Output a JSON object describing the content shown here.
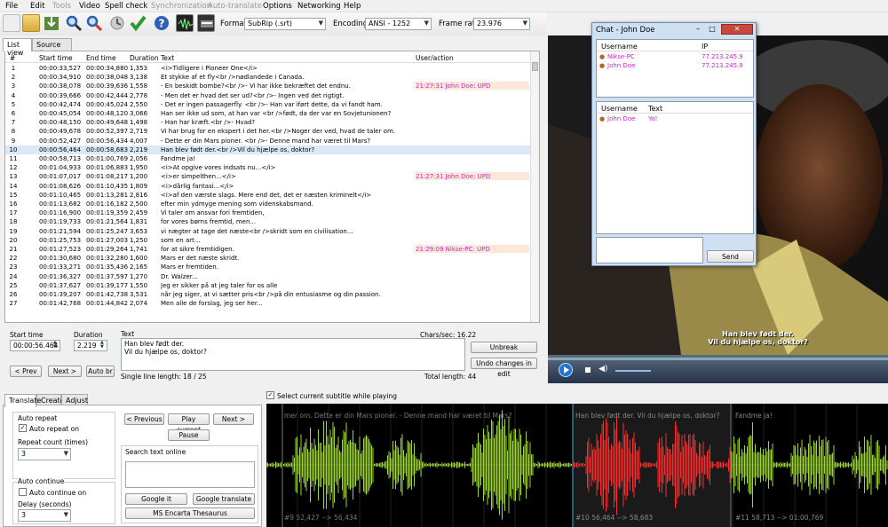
{
  "menu": [
    "File",
    "Edit",
    "Tools",
    "Video",
    "Spell check",
    "Synchronization",
    "Auto-translate",
    "Options",
    "Networking",
    "Help"
  ],
  "menu_disabled": [
    false,
    false,
    true,
    false,
    false,
    true,
    true,
    false,
    false,
    false
  ],
  "toolbar": {
    "format_label": "Format",
    "format_value": "SubRip (.srt)",
    "encoding_label": "Encoding",
    "encoding_value": "ANSI - 1252",
    "framerate_label": "Frame rate",
    "framerate_value": "23.976"
  },
  "tabs": {
    "list": "List view",
    "source": "Source view"
  },
  "columns": {
    "num": "#",
    "start": "Start time",
    "end": "End time",
    "dur": "Duration",
    "text": "Text",
    "ua": "User/action"
  },
  "rows": [
    [
      "1",
      "00:00:33,527",
      "00:00:34,880",
      "1,353",
      "<i>Tidligere i Pioneer One</i>",
      ""
    ],
    [
      "2",
      "00:00:34,910",
      "00:00:38,048",
      "3,138",
      "Et stykke af et fly<br />nødlandede i Canada.",
      ""
    ],
    [
      "3",
      "00:00:38,078",
      "00:00:39,636",
      "1,558",
      "- En beskidt bombe?<br />- Vi har ikke bekræftet det endnu.",
      "21:27:31 John Doe: UPD"
    ],
    [
      "4",
      "00:00:39,666",
      "00:00:42,444",
      "2,778",
      "- Men det er hvad det ser ud?<br />- Ingen ved det rigtigt.",
      ""
    ],
    [
      "5",
      "00:00:42,474",
      "00:00:45,024",
      "2,550",
      "- Det er ingen passagerfly. <br />- Han var iført dette, da vi fandt ham.",
      ""
    ],
    [
      "6",
      "00:00:45,054",
      "00:00:48,120",
      "3,066",
      "Han ser ikke ud som, at han var <br />født, da der var en Sovjetunionen?",
      ""
    ],
    [
      "7",
      "00:00:48,150",
      "00:00:49,648",
      "1,498",
      "- Han har kræft.<br />- Hvad?",
      ""
    ],
    [
      "8",
      "00:00:49,678",
      "00:00:52,397",
      "2,719",
      "Vi har brug for en ekspert i det her.<br />Noger der ved, hvad de taler om.",
      ""
    ],
    [
      "9",
      "00:00:52,427",
      "00:00:56,434",
      "4,007",
      "- Dette er din Mars pioner. <br />- Denne mand har været til Mars?",
      ""
    ],
    [
      "10",
      "00:00:56,464",
      "00:00:58,683",
      "2,219",
      "Han blev født der.<br />Vil du hjælpe os, doktor?",
      ""
    ],
    [
      "11",
      "00:00:58,713",
      "00:01:00,769",
      "2,056",
      "Fandme ja!",
      ""
    ],
    [
      "12",
      "00:01:04,933",
      "00:01:06,883",
      "1,950",
      "<i>At opgive vores indsats nu...</i>",
      ""
    ],
    [
      "13",
      "00:01:07,017",
      "00:01:08,217",
      "1,200",
      "<i>er simpelthen...</i>",
      "21:27:31 John Doe: UPD"
    ],
    [
      "14",
      "00:01:08,626",
      "00:01:10,435",
      "1,809",
      "<i>dårlig fantasi...</i>",
      ""
    ],
    [
      "15",
      "00:01:10,465",
      "00:01:13,281",
      "2,816",
      "<i>af den værste slags. Mere end det, det er næsten kriminelt</i>",
      ""
    ],
    [
      "16",
      "00:01:13,682",
      "00:01:16,182",
      "2,500",
      "efter min ydmyge mening som videnskabsmand.",
      ""
    ],
    [
      "17",
      "00:01:16,900",
      "00:01:19,359",
      "2,459",
      "Vi taler om ansvar fori fremtiden,",
      ""
    ],
    [
      "18",
      "00:01:19,733",
      "00:01:21,564",
      "1,831",
      "for vores børns fremtid, men...",
      ""
    ],
    [
      "19",
      "00:01:21,594",
      "00:01:25,247",
      "3,653",
      "vi nægter at tage det næste<br />skridt som en civilisation...",
      ""
    ],
    [
      "20",
      "00:01:25,753",
      "00:01:27,003",
      "1,250",
      "som en art...",
      ""
    ],
    [
      "21",
      "00:01:27,523",
      "00:01:29,264",
      "1,741",
      "for at sikre fremtidigen.",
      "21:29:09 Nikse-PC: UPD"
    ],
    [
      "22",
      "00:01:30,680",
      "00:01:32,280",
      "1,600",
      "Mars er det næste skridt.",
      ""
    ],
    [
      "23",
      "00:01:33,271",
      "00:01:35,436",
      "2,165",
      "Mars er fremtiden.",
      ""
    ],
    [
      "24",
      "00:01:36,327",
      "00:01:37,597",
      "1,270",
      "Dr. Walzer...",
      ""
    ],
    [
      "25",
      "00:01:37,627",
      "00:01:39,177",
      "1,550",
      "Jeg er sikker på at jeg taler for os alle",
      ""
    ],
    [
      "26",
      "00:01:39,207",
      "00:01:42,738",
      "3,531",
      "når jeg siger, at vi sætter pris<br />på din entusiasme og din passion.",
      ""
    ],
    [
      "27",
      "00:01:42,768",
      "00:01:44,842",
      "2,074",
      "Men alle de forslag, jeg ser her...",
      ""
    ]
  ],
  "editor": {
    "start_label": "Start time",
    "start_value": "00:00:56.464",
    "dur_label": "Duration",
    "dur_value": "2.219",
    "text_label": "Text",
    "text_line1": "Han blev født der.",
    "text_line2": "Vil du hjælpe os, doktor?",
    "chars_sec": "Chars/sec: 16.22",
    "single_line": "Single line length: 18 / 25",
    "total_length": "Total length: 44",
    "prev": "< Prev",
    "next": "Next >",
    "auto_br": "Auto br",
    "unbreak": "Unbreak",
    "undo": "Undo changes in edit"
  },
  "chat": {
    "title": "Chat - John Doe",
    "users_col": "Username",
    "ip_col": "IP",
    "users": [
      {
        "name": "Nikse-PC",
        "ip": "77.213.245.9"
      },
      {
        "name": "John Doe",
        "ip": "77.213.245.9"
      }
    ],
    "msg_user_col": "Username",
    "msg_text_col": "Text",
    "messages": [
      {
        "user": "John Doe",
        "text": "Yo!"
      }
    ],
    "send": "Send"
  },
  "video": {
    "subtitle_line1": "Han blev født der.",
    "subtitle_line2": "Vil du hjælpe os, doktor?"
  },
  "bottom": {
    "tabs": [
      "Translate",
      "Create",
      "Adjust"
    ],
    "select_current": "Select current subtitle while playing",
    "auto_repeat": "Auto repeat",
    "auto_repeat_on": "Auto repeat on",
    "repeat_count": "Repeat count (times)",
    "repeat_value": "3",
    "auto_continue": "Auto continue",
    "auto_continue_on": "Auto continue on",
    "delay": "Delay (seconds)",
    "delay_value": "3",
    "previous": "< Previous",
    "play_current": "Play current",
    "next": "Next >",
    "pause": "Pause",
    "search_online": "Search text online",
    "google_it": "Google it",
    "google_translate": "Google translate",
    "ms_encarta": "MS Encarta Thesaurus"
  },
  "waveform": {
    "labels": [
      {
        "top": "mer om. Dette er din Mars pioner. - Denne mand har været til Mars?",
        "bottom": "#9  52,427 --> 56,434"
      },
      {
        "top": "Han blev født der. Vil du hjælpe os, doktor?",
        "bottom": "#10  56,464 --> 58,683"
      },
      {
        "top": "Fandme ja!",
        "bottom": "#11  58,713 --> 01:00,769"
      }
    ]
  }
}
